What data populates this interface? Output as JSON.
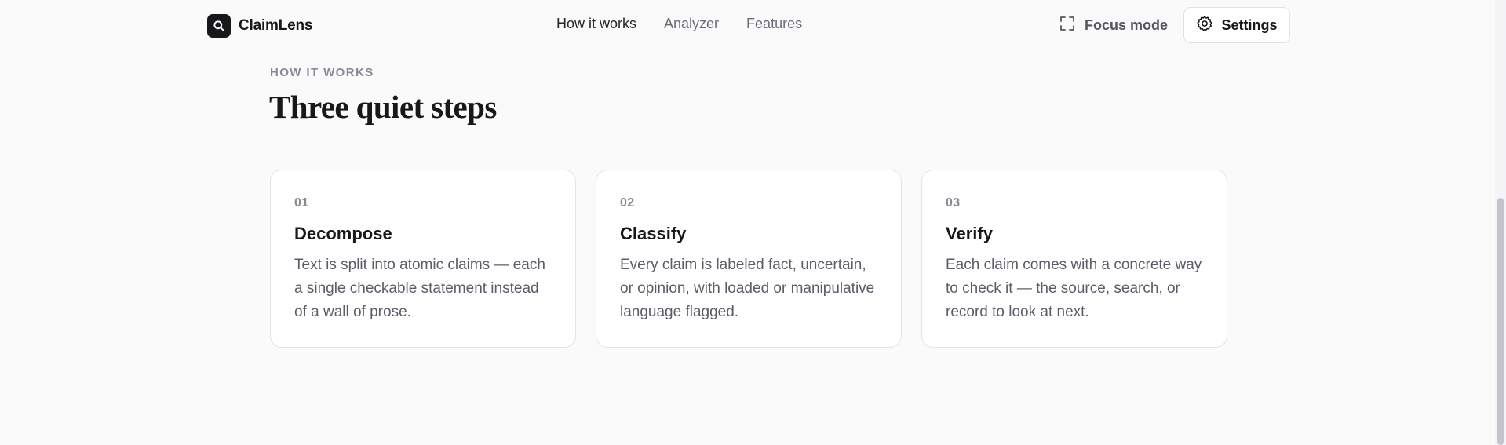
{
  "header": {
    "brand": "ClaimLens",
    "nav": [
      {
        "label": "How it works",
        "active": true
      },
      {
        "label": "Analyzer",
        "active": false
      },
      {
        "label": "Features",
        "active": false
      }
    ],
    "focus_mode_label": "Focus mode",
    "settings_label": "Settings"
  },
  "section": {
    "eyebrow": "HOW IT WORKS",
    "title": "Three quiet steps",
    "steps": [
      {
        "num": "01",
        "title": "Decompose",
        "desc": "Text is split into atomic claims — each a single checkable statement instead of a wall of prose."
      },
      {
        "num": "02",
        "title": "Classify",
        "desc": "Every claim is labeled fact, uncertain, or opinion, with loaded or manipulative language flagged."
      },
      {
        "num": "03",
        "title": "Verify",
        "desc": "Each claim comes with a concrete way to check it — the source, search, or record to look at next."
      }
    ]
  },
  "icons": {
    "brand": "search-icon",
    "focus": "expand-icon",
    "settings": "gear-icon"
  }
}
